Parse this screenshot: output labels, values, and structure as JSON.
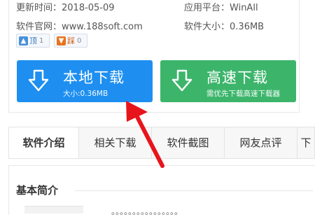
{
  "meta": {
    "update_time_label": "更新时间：",
    "update_time_value": "2018-05-09",
    "platform_label": "应用平台：",
    "platform_value": "WinAll",
    "website_label": "软件官网：",
    "website_value": "www.188soft.com",
    "size_label": "软件大小：",
    "size_value": "0.36MB"
  },
  "votes": {
    "up_label": "顶",
    "up_count": "1",
    "down_label": "踩",
    "down_count": "0"
  },
  "downloads": {
    "local": {
      "title": "本地下载",
      "subtitle": "大小:0.36MB",
      "color": "#1e8ff0"
    },
    "fast": {
      "title": "高速下载",
      "subtitle": "需优先下载高速下载器",
      "color": "#3cb56b"
    }
  },
  "annotation": {
    "arrow_color": "#e8141c"
  },
  "tabs": [
    {
      "label": "软件介绍"
    },
    {
      "label": "相关下载"
    },
    {
      "label": "软件截图"
    },
    {
      "label": "网友点评"
    },
    {
      "label": "下"
    }
  ],
  "intro": {
    "title": "基本简介",
    "truncated_text": "。。。。。。。。。。。。。。。。"
  }
}
